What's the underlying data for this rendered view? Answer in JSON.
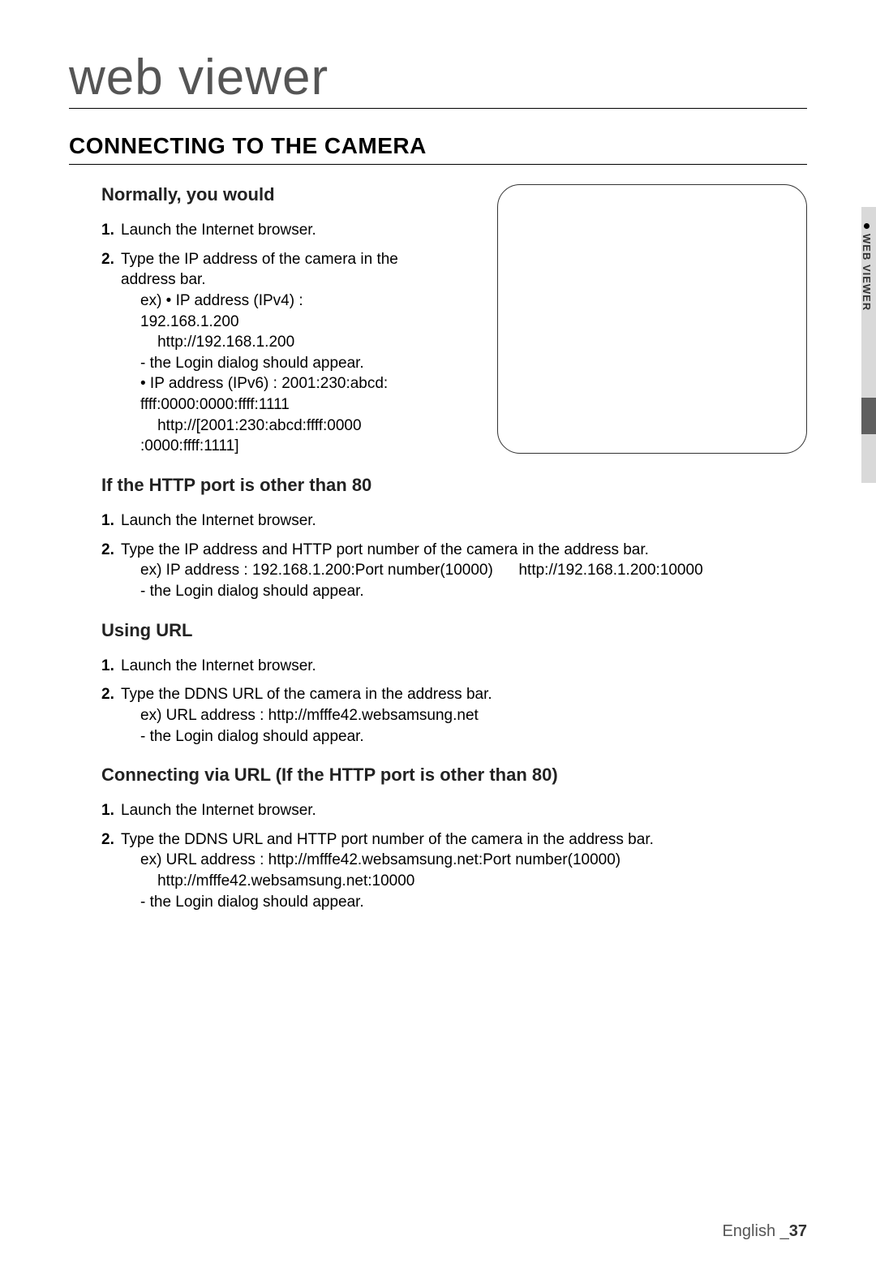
{
  "chapter": "web viewer",
  "section_heading": "CONNECTING TO THE CAMERA",
  "side_tab": "WEB VIEWER",
  "sections": [
    {
      "title": "Normally, you would",
      "narrow": true,
      "items": [
        {
          "num": "1.",
          "lines": [
            "Launch the Internet browser."
          ]
        },
        {
          "num": "2.",
          "lines": [
            "Type the IP address of the camera in the address bar.",
            "ex) • IP address (IPv4) : 192.168.1.200",
            "    http://192.168.1.200",
            "- the Login dialog should appear.",
            "• IP address (IPv6) : 2001:230:abcd: ffff:0000:0000:ffff:1111",
            "    http://[2001:230:abcd:ffff:0000 :0000:ffff:1111]"
          ]
        }
      ]
    },
    {
      "title": "If the HTTP port is other than 80",
      "items": [
        {
          "num": "1.",
          "lines": [
            "Launch the Internet browser."
          ]
        },
        {
          "num": "2.",
          "lines": [
            "Type the IP address and HTTP port number of the camera in the address bar.",
            "ex) IP address : 192.168.1.200:Port number(10000)      http://192.168.1.200:10000",
            "- the Login dialog should appear."
          ]
        }
      ]
    },
    {
      "title": "Using URL",
      "items": [
        {
          "num": "1.",
          "lines": [
            "Launch the Internet browser."
          ]
        },
        {
          "num": "2.",
          "lines": [
            "Type the DDNS URL of the camera in the address bar.",
            "ex) URL address : http://mfffe42.websamsung.net",
            "- the Login dialog should appear."
          ]
        }
      ]
    },
    {
      "title": "Connecting via URL (If the HTTP port is other than 80)",
      "items": [
        {
          "num": "1.",
          "lines": [
            "Launch the Internet browser."
          ]
        },
        {
          "num": "2.",
          "lines": [
            "Type the DDNS URL and HTTP port number of the camera in the address bar.",
            "ex) URL address : http://mfffe42.websamsung.net:Port number(10000)",
            "    http://mfffe42.websamsung.net:10000",
            "- the Login dialog should appear."
          ]
        }
      ]
    }
  ],
  "footer": {
    "lang": "English _",
    "page": "37"
  }
}
